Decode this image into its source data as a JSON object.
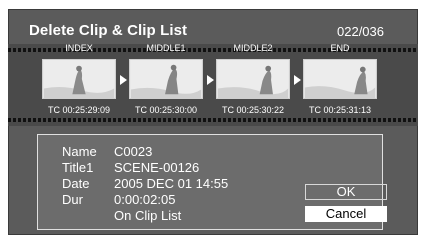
{
  "dialog": {
    "title": "Delete Clip & Clip List",
    "counter": "022/036"
  },
  "thumbnails": [
    {
      "label": "INDEX",
      "timecode": "TC 00:25:29:09"
    },
    {
      "label": "MIDDLE1",
      "timecode": "TC 00:25:30:00"
    },
    {
      "label": "MIDDLE2",
      "timecode": "TC 00:25:30:22"
    },
    {
      "label": "END",
      "timecode": "TC 00:25:31:13"
    }
  ],
  "info": {
    "name_label": "Name",
    "name_value": "C0023",
    "title1_label": "Title1",
    "title1_value": "SCENE-00126",
    "date_label": "Date",
    "date_value": "2005 DEC 01 14:55",
    "dur_label": "Dur",
    "dur_value": "0:00:02:05",
    "list_note": "On Clip List"
  },
  "buttons": {
    "ok_label": "OK",
    "cancel_label": "Cancel"
  }
}
